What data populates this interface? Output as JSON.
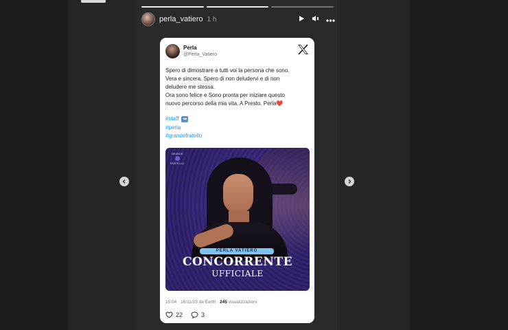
{
  "story": {
    "username": "perla_vatiero",
    "time": "1 h",
    "progress_segments": [
      1,
      1,
      0
    ]
  },
  "tweet": {
    "author_name": "Perla",
    "handle": "@Perla_Vatiero",
    "body_lines": [
      "Spero di dimostrare a tutti voi la persona che sono.",
      "Vera e sincera. Spero di non deludervi e di non",
      "deludere me stessa.",
      "Ora sono felice e Sono pronta per iniziare questo",
      "nuovo percorso della mia vita. A Presto. Perla❤️"
    ],
    "hashtags": [
      "#staff",
      "#perla",
      "#grandefratello"
    ],
    "poster": {
      "brand_top": "GRANDE",
      "brand_bottom": "FRATELLO",
      "nameplate": "PERLA VATIERO",
      "headline": "CONCORRENTE",
      "subheadline": "UFFICIALE"
    },
    "meta_prefix": "15:04 · 16/11/23 da Earth · ",
    "views_count": "245",
    "views_label": " visualizzazioni",
    "likes": "22",
    "replies": "3"
  },
  "icons": {
    "play": "play-icon",
    "mute": "volume-icon",
    "more": "more-icon",
    "prev": "chevron-left-icon",
    "next": "chevron-right-icon",
    "x_logo": "x-logo-icon",
    "like": "heart-icon",
    "reply": "comment-icon"
  },
  "colors": {
    "link": "#1d9bf0",
    "poster_bg": "#2a1e5e",
    "nameplate": "#7fc3f0"
  }
}
